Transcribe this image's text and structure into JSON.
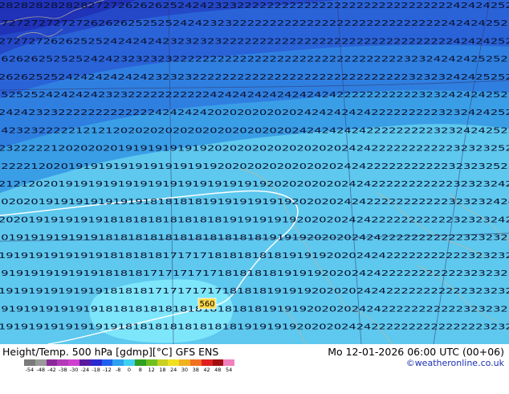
{
  "map": {
    "title": "Height/Temp. 500 hPa [gdmp][°C] GFS ENS",
    "valid": "Mo 12-01-2026 06:00 UTC (00+06)",
    "credit": "©weatheronline.co.uk",
    "contour_label": "560",
    "grid_rows": [
      "2828282828282727262626252424232322222222222222222222222222222424242525",
      "2727272727272626262525252424232322222222222222222222222222222424242525",
      "2727272626252524242424232323232222222222222222222222222222222424242525",
      "2626262525252424232323232222222222222222222222222222222323242424252525",
      "2626252524242424242423232322222222222222222222222222222323232424252525",
      "2525252424242423232222222222242424242424242424222222222223232424242525",
      "2424232322222222222224242424202020202020242424242422222222232324242525",
      "2423232222212121202020202020202020202020242424242422222222232324242525",
      "2322222120202020191919191919202020202020202020242422222222222323232525",
      "2222212020191919191919191919192020202020202020242422222222222323232525",
      "2121202019191919191919191919191919192020202020242422222222222323232424",
      "2020201919191919191918181818191919191919202020242422222222222323232424",
      "2020191919191918181818181818181919191919202020242422222222222323232424",
      "2019191919191918181818181818181818181919192020202424222222222223232323",
      "1919191919191918181818171717181818181819191920202424222222222223232323",
      "1919191919191918181817171717171818181819191920202424222222222223232323",
      "1919191919191918181817171717171818181919192020202424222222222223232323",
      "1919191919191918181818181818181818181919192020202424222222222223232323",
      "1919191919191919181818181818181819191919202020242422222222222222232323"
    ],
    "colorbar": {
      "ticks": [
        "-54",
        "-48",
        "-42",
        "-38",
        "-30",
        "-24",
        "-18",
        "-12",
        "-8",
        "0",
        "8",
        "12",
        "18",
        "24",
        "30",
        "38",
        "42",
        "48",
        "54"
      ],
      "colors": [
        "#7a7a7a",
        "#9a9a9a",
        "#8a2a9a",
        "#b23ab8",
        "#d040d0",
        "#5a1aa0",
        "#2a2ad0",
        "#2060f0",
        "#30a0f0",
        "#40d0f0",
        "#30a020",
        "#70c020",
        "#c8d020",
        "#f0e020",
        "#f0b020",
        "#f07020",
        "#e02020",
        "#a01010",
        "#f080c0"
      ]
    }
  }
}
